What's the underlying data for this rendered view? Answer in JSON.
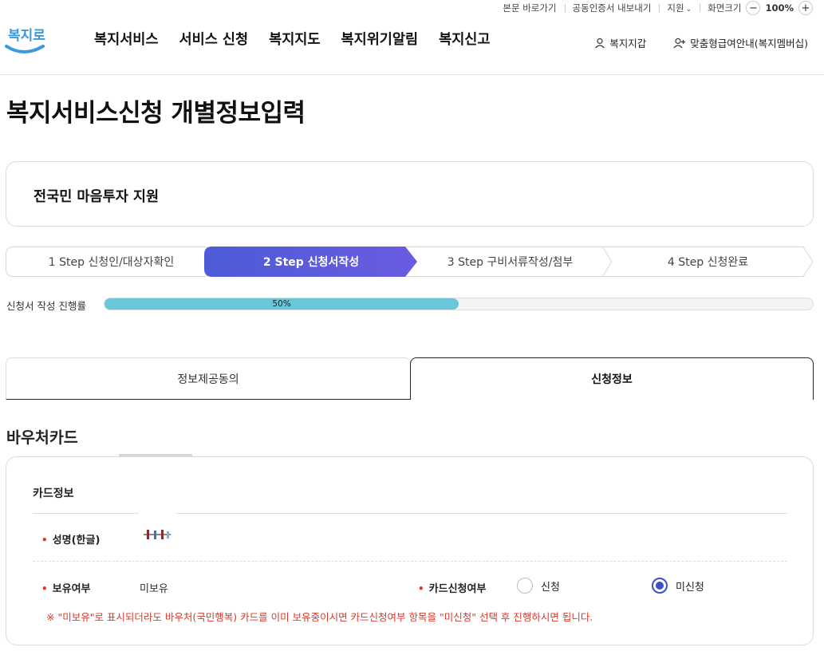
{
  "utility": {
    "skip_link": "본문 바로가기",
    "cert_export": "공동인증서 내보내기",
    "support": "지원",
    "zoom_label": "화면크기",
    "zoom_minus": "−",
    "zoom_value": "100%",
    "zoom_plus": "+"
  },
  "header": {
    "logo_text": "복지로",
    "nav": [
      "복지서비스",
      "서비스 신청",
      "복지지도",
      "복지위기알림",
      "복지신고"
    ],
    "wallet": "복지지갑",
    "membership": "맞춤형급여안내(복지멤버십)"
  },
  "page_title": "복지서비스신청 개별정보입력",
  "service_name": "전국민 마음투자 지원",
  "steps": [
    {
      "label": "1 Step 신청인/대상자확인",
      "active": false
    },
    {
      "label": "2 Step 신청서작성",
      "active": true
    },
    {
      "label": "3 Step 구비서류작성/첨부",
      "active": false
    },
    {
      "label": "4 Step 신청완료",
      "active": false
    }
  ],
  "progress": {
    "label": "신청서 작성 진행률",
    "value": 0.5,
    "text": "50%"
  },
  "tabs": [
    {
      "label": "정보제공동의",
      "active": false
    },
    {
      "label": "신청정보",
      "active": true
    }
  ],
  "section": {
    "title": "바우처카드",
    "card_title": "카드정보",
    "name_label": "성명(한글)",
    "holding_label": "보유여부",
    "holding_value": "미보유",
    "apply_label": "카드신청여부",
    "options": [
      {
        "label": "신청",
        "selected": false
      },
      {
        "label": "미신청",
        "selected": true
      }
    ],
    "note": "※ \"미보유\"로 표시되더라도 바우처(국민행복) 카드를 이미 보유중이시면 카드신청여부 항목을 \"미신청\" 선택 후 진행하시면 됩니다."
  },
  "colors": {
    "active_step_start": "#4d5bd6",
    "active_step_end": "#6a5ce0",
    "progress_fill": "#6cc6d9",
    "required_mark": "#e0312b",
    "radio_selected": "#3d4fc9",
    "note": "#d9392b",
    "logo_blue": "#3b9ad9"
  }
}
